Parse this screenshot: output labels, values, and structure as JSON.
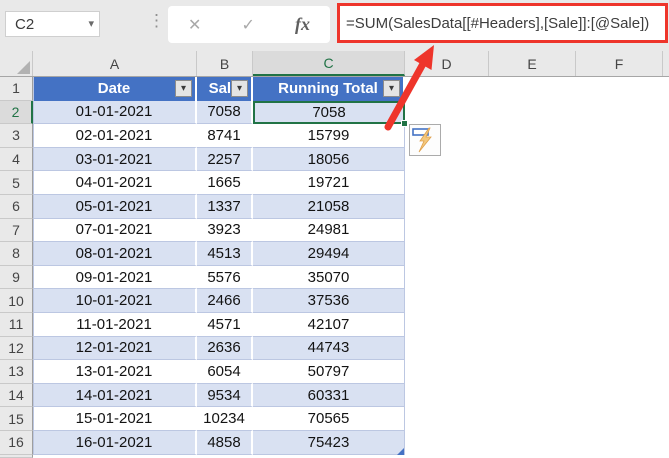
{
  "name_box": {
    "value": "C2",
    "dropdown_icon": "▾"
  },
  "toolbar": {
    "dots_icon": "⋮",
    "cancel_icon": "✕",
    "check_icon": "✓",
    "fx_icon": "fx"
  },
  "formula_bar": {
    "formula": "=SUM(SalesData[[#Headers],[Sale]]:[@Sale])"
  },
  "sheet": {
    "column_letters": [
      "A",
      "B",
      "C",
      "D",
      "E",
      "F"
    ],
    "selected_column": "C",
    "selected_cell": "C2",
    "header_row_number": 1,
    "filter_icon": "▾",
    "table": {
      "name": "SalesData",
      "headers": [
        "Date",
        "Sale",
        "Running Total"
      ],
      "rows": [
        {
          "n": 2,
          "date": "01-01-2021",
          "sale": "7058",
          "total": "7058"
        },
        {
          "n": 3,
          "date": "02-01-2021",
          "sale": "8741",
          "total": "15799"
        },
        {
          "n": 4,
          "date": "03-01-2021",
          "sale": "2257",
          "total": "18056"
        },
        {
          "n": 5,
          "date": "04-01-2021",
          "sale": "1665",
          "total": "19721"
        },
        {
          "n": 6,
          "date": "05-01-2021",
          "sale": "1337",
          "total": "21058"
        },
        {
          "n": 7,
          "date": "07-01-2021",
          "sale": "3923",
          "total": "24981"
        },
        {
          "n": 8,
          "date": "08-01-2021",
          "sale": "4513",
          "total": "29494"
        },
        {
          "n": 9,
          "date": "09-01-2021",
          "sale": "5576",
          "total": "35070"
        },
        {
          "n": 10,
          "date": "10-01-2021",
          "sale": "2466",
          "total": "37536"
        },
        {
          "n": 11,
          "date": "11-01-2021",
          "sale": "4571",
          "total": "42107"
        },
        {
          "n": 12,
          "date": "12-01-2021",
          "sale": "2636",
          "total": "44743"
        },
        {
          "n": 13,
          "date": "13-01-2021",
          "sale": "6054",
          "total": "50797"
        },
        {
          "n": 14,
          "date": "14-01-2021",
          "sale": "9534",
          "total": "60331"
        },
        {
          "n": 15,
          "date": "15-01-2021",
          "sale": "10234",
          "total": "70565"
        },
        {
          "n": 16,
          "date": "16-01-2021",
          "sale": "4858",
          "total": "75423"
        }
      ]
    }
  },
  "colors": {
    "table_header_blue": "#4472C4",
    "band_blue": "#D9E1F2",
    "selection_green": "#217346",
    "annotation_red": "#EE352B",
    "bolt_orange": "#F3C87E"
  }
}
